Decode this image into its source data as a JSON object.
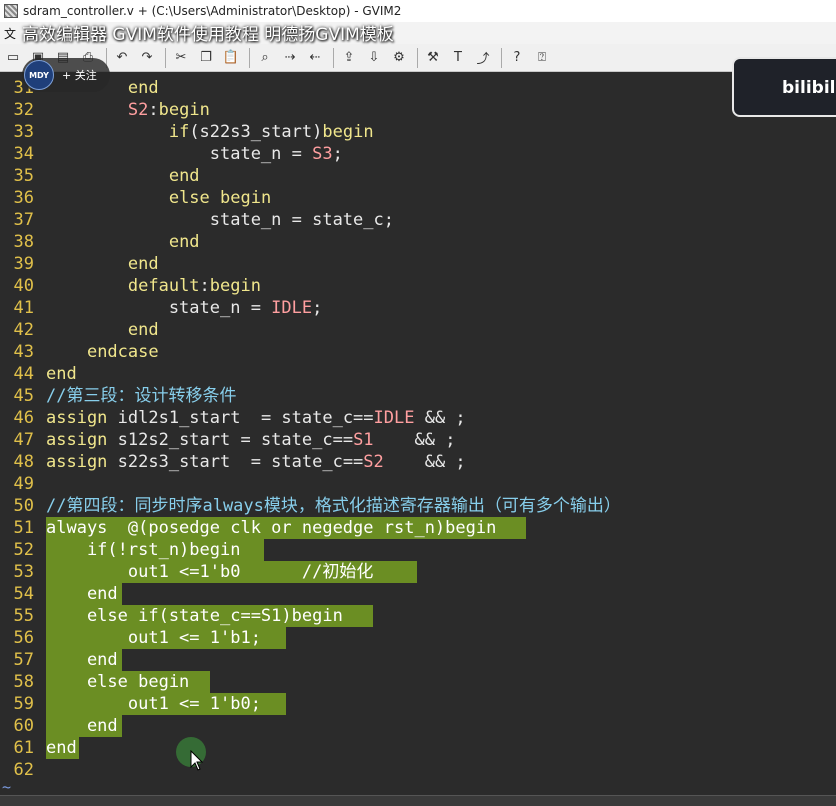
{
  "window": {
    "title": "sdram_controller.v + (C:\\Users\\Administrator\\Desktop) - GVIM2"
  },
  "menu": {
    "first_item": "文"
  },
  "video_overlay": {
    "title": "高效编辑器 GVIM软件使用教程 明德扬GVIM模板",
    "avatar_text": "MDY",
    "follow_label": "+ 关注",
    "card_text": "bilibil"
  },
  "toolbar": {
    "icons": [
      "open-icon",
      "save-icon",
      "save-all-icon",
      "print-icon",
      "undo-icon",
      "redo-icon",
      "cut-icon",
      "copy-icon",
      "paste-icon",
      "find-icon",
      "find-next-icon",
      "find-prev-icon",
      "load-session-icon",
      "save-session-icon",
      "run-script-icon",
      "make-icon",
      "tags-icon",
      "jump-tag-icon",
      "help-icon",
      "find-help-icon"
    ]
  },
  "editor": {
    "colors": {
      "background": "#2b2b2b",
      "line_number": "#e0c04a",
      "keyword": "#f0e68c",
      "string": "#ff9fa0",
      "comment": "#87ceeb",
      "selection": "#6b8e23"
    },
    "lines": [
      {
        "n": "31",
        "segs": [
          {
            "t": "        ",
            "c": "pl"
          },
          {
            "t": "end",
            "c": "kw"
          }
        ]
      },
      {
        "n": "32",
        "segs": [
          {
            "t": "        ",
            "c": "pl"
          },
          {
            "t": "S2",
            "c": "st"
          },
          {
            "t": ":",
            "c": "pl"
          },
          {
            "t": "begin",
            "c": "kw"
          }
        ]
      },
      {
        "n": "33",
        "segs": [
          {
            "t": "            ",
            "c": "pl"
          },
          {
            "t": "if",
            "c": "kw"
          },
          {
            "t": "(s22s3_start)",
            "c": "pl"
          },
          {
            "t": "begin",
            "c": "kw"
          }
        ]
      },
      {
        "n": "34",
        "segs": [
          {
            "t": "                state_n = ",
            "c": "pl"
          },
          {
            "t": "S3",
            "c": "st"
          },
          {
            "t": ";",
            "c": "pl"
          }
        ]
      },
      {
        "n": "35",
        "segs": [
          {
            "t": "            ",
            "c": "pl"
          },
          {
            "t": "end",
            "c": "kw"
          }
        ]
      },
      {
        "n": "36",
        "segs": [
          {
            "t": "            ",
            "c": "pl"
          },
          {
            "t": "else begin",
            "c": "kw"
          }
        ]
      },
      {
        "n": "37",
        "segs": [
          {
            "t": "                state_n = state_c;",
            "c": "pl"
          }
        ]
      },
      {
        "n": "38",
        "segs": [
          {
            "t": "            ",
            "c": "pl"
          },
          {
            "t": "end",
            "c": "kw"
          }
        ]
      },
      {
        "n": "39",
        "segs": [
          {
            "t": "        ",
            "c": "pl"
          },
          {
            "t": "end",
            "c": "kw"
          }
        ]
      },
      {
        "n": "40",
        "segs": [
          {
            "t": "        ",
            "c": "pl"
          },
          {
            "t": "default",
            "c": "kw"
          },
          {
            "t": ":",
            "c": "pl"
          },
          {
            "t": "begin",
            "c": "kw"
          }
        ]
      },
      {
        "n": "41",
        "segs": [
          {
            "t": "            state_n = ",
            "c": "pl"
          },
          {
            "t": "IDLE",
            "c": "st"
          },
          {
            "t": ";",
            "c": "pl"
          }
        ]
      },
      {
        "n": "42",
        "segs": [
          {
            "t": "        ",
            "c": "pl"
          },
          {
            "t": "end",
            "c": "kw"
          }
        ]
      },
      {
        "n": "43",
        "segs": [
          {
            "t": "    ",
            "c": "pl"
          },
          {
            "t": "endcase",
            "c": "kw"
          }
        ]
      },
      {
        "n": "44",
        "segs": [
          {
            "t": "end",
            "c": "kw"
          }
        ]
      },
      {
        "n": "45",
        "segs": [
          {
            "t": "//第三段：设计转移条件",
            "c": "cm"
          }
        ]
      },
      {
        "n": "46",
        "segs": [
          {
            "t": "assign",
            "c": "kw"
          },
          {
            "t": " idl2s1_start  = state_c==",
            "c": "pl"
          },
          {
            "t": "IDLE",
            "c": "st"
          },
          {
            "t": " && ;",
            "c": "pl"
          }
        ]
      },
      {
        "n": "47",
        "segs": [
          {
            "t": "assign",
            "c": "kw"
          },
          {
            "t": " s12s2_start = state_c==",
            "c": "pl"
          },
          {
            "t": "S1",
            "c": "st"
          },
          {
            "t": "    && ;",
            "c": "pl"
          }
        ]
      },
      {
        "n": "48",
        "segs": [
          {
            "t": "assign",
            "c": "kw"
          },
          {
            "t": " s22s3_start  = state_c==",
            "c": "pl"
          },
          {
            "t": "S2",
            "c": "st"
          },
          {
            "t": "    && ;",
            "c": "pl"
          }
        ]
      },
      {
        "n": "49",
        "segs": []
      },
      {
        "n": "50",
        "segs": [
          {
            "t": "//第四段：同步时序always模块，格式化描述寄存器输出（可有多个输出）",
            "c": "cm"
          }
        ]
      },
      {
        "n": "51",
        "hl": 44,
        "segs": [
          {
            "t": "always  @(posedge clk or negedge rst_n)begin",
            "c": "kw"
          }
        ]
      },
      {
        "n": "52",
        "hl": 20,
        "segs": [
          {
            "t": "    if(!rst_n)begin",
            "c": "kw"
          }
        ]
      },
      {
        "n": "53",
        "hl": 34,
        "segs": [
          {
            "t": "        out1 <=1'b0      //初始化",
            "c": "pl"
          }
        ]
      },
      {
        "n": "54",
        "hl": 7,
        "segs": [
          {
            "t": "    end",
            "c": "kw"
          }
        ]
      },
      {
        "n": "55",
        "hl": 30,
        "segs": [
          {
            "t": "    else if(state_c==S1)begin",
            "c": "kw"
          }
        ]
      },
      {
        "n": "56",
        "hl": 22,
        "segs": [
          {
            "t": "        out1 <= 1'b1;",
            "c": "pl"
          }
        ]
      },
      {
        "n": "57",
        "hl": 7,
        "segs": [
          {
            "t": "    end",
            "c": "kw"
          }
        ]
      },
      {
        "n": "58",
        "hl": 15,
        "segs": [
          {
            "t": "    else begin",
            "c": "kw"
          }
        ]
      },
      {
        "n": "59",
        "hl": 22,
        "segs": [
          {
            "t": "        out1 <= 1'b0;",
            "c": "pl"
          }
        ]
      },
      {
        "n": "60",
        "hl": 7,
        "segs": [
          {
            "t": "    end",
            "c": "kw"
          }
        ]
      },
      {
        "n": "61",
        "hl": 3,
        "segs": [
          {
            "t": "end",
            "c": "kw"
          }
        ]
      },
      {
        "n": "62",
        "segs": []
      }
    ]
  },
  "tilde": "~"
}
